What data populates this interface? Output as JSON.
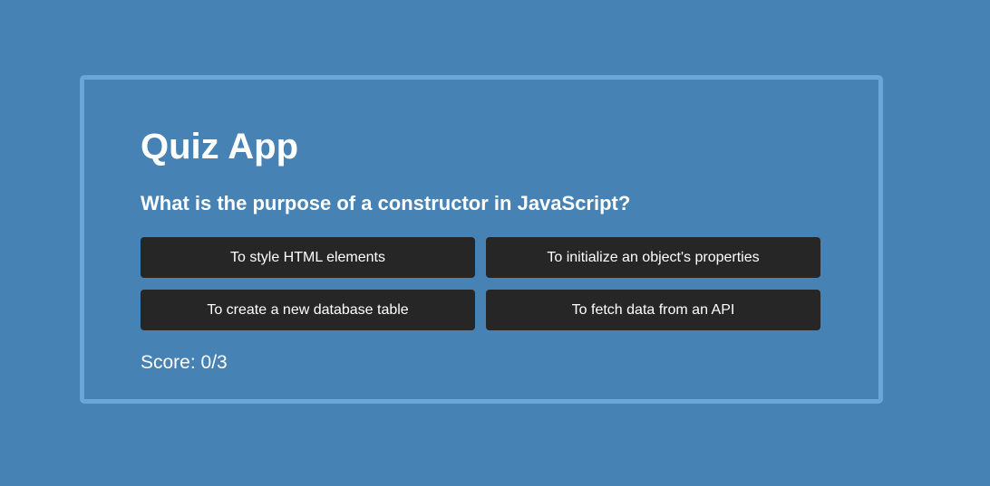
{
  "app": {
    "title": "Quiz App"
  },
  "question": {
    "text": "What is the purpose of a constructor in JavaScript?"
  },
  "answers": [
    {
      "label": "To style HTML elements"
    },
    {
      "label": "To initialize an object's properties"
    },
    {
      "label": "To create a new database table"
    },
    {
      "label": "To fetch data from an API"
    }
  ],
  "score": {
    "text": "Score: 0/3"
  },
  "colors": {
    "background": "#4682b4",
    "card_border": "#6ca6d8",
    "button": "#262626",
    "text": "#ffffff"
  }
}
